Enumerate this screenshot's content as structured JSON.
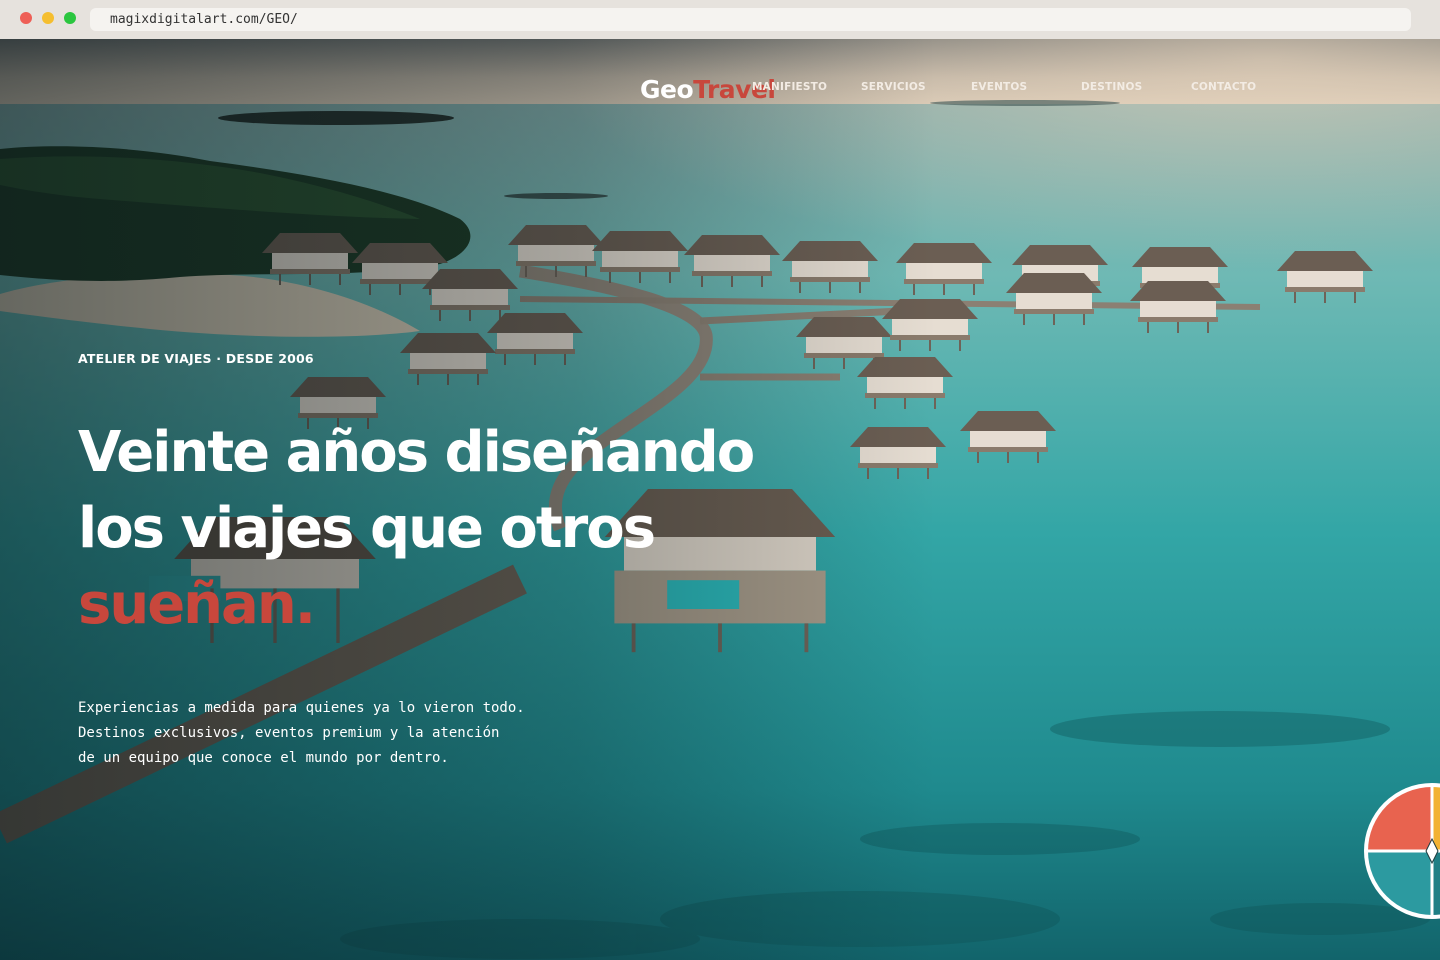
{
  "browser": {
    "url": "magixdigitalart.com/GEO/"
  },
  "header": {
    "logo_part1": "Geo",
    "logo_part2": "Travel",
    "nav": [
      "MANIFIESTO",
      "SERVICIOS",
      "EVENTOS",
      "DESTINOS",
      "CONTACTO"
    ]
  },
  "hero": {
    "eyebrow": "ATELIER DE VIAJES · DESDE 2006",
    "headline_line1": "Veinte años diseñando",
    "headline_line2": "los viajes que otros",
    "headline_accent": "sueñan.",
    "description": [
      "Experiencias a medida para quienes ya lo vieron todo.",
      "Destinos exclusivos, eventos premium y la atención",
      "de un equipo que conoce el mundo por dentro."
    ],
    "background_icon": "overwater-villas-photo"
  },
  "widgets": {
    "compass_icon": "compass-icon"
  },
  "colors": {
    "accent": "#c8473c",
    "sea": "#2f9a9c",
    "sky": "#c9bcab"
  }
}
